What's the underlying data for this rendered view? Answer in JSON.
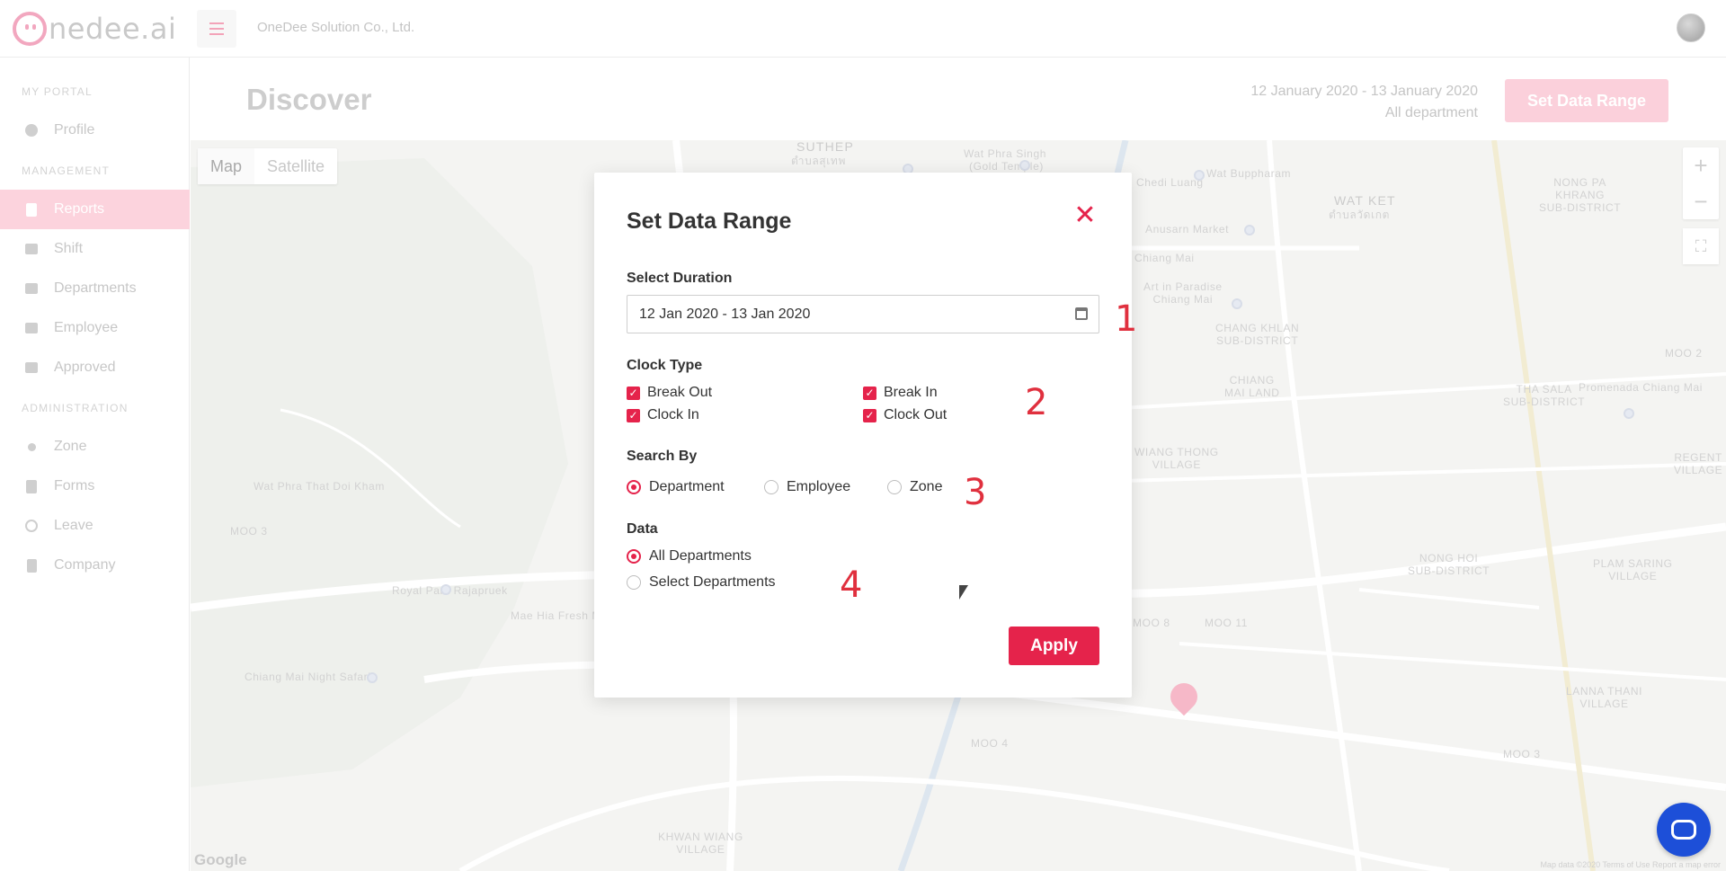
{
  "app": {
    "logo_text": "nedee.ai",
    "company_name": "OneDee Solution Co., Ltd."
  },
  "sidebar": {
    "sections": [
      {
        "title": "MY PORTAL"
      },
      {
        "title": "MANAGEMENT"
      },
      {
        "title": "ADMINISTRATION"
      }
    ],
    "items": [
      {
        "label": "Profile",
        "icon": "user-circle-icon"
      },
      {
        "label": "Reports",
        "icon": "file-icon",
        "active": true
      },
      {
        "label": "Shift",
        "icon": "shift-icon"
      },
      {
        "label": "Departments",
        "icon": "users-icon"
      },
      {
        "label": "Employee",
        "icon": "id-card-icon"
      },
      {
        "label": "Approved",
        "icon": "inbox-icon"
      },
      {
        "label": "Zone",
        "icon": "map-pin-icon"
      },
      {
        "label": "Forms",
        "icon": "clipboard-icon"
      },
      {
        "label": "Leave",
        "icon": "x-circle-icon"
      },
      {
        "label": "Company",
        "icon": "building-icon"
      }
    ]
  },
  "header": {
    "title": "Discover",
    "date_range": "12 January 2020 - 13 January 2020",
    "scope": "All department",
    "button_label": "Set Data Range"
  },
  "map": {
    "type_options": [
      "Map",
      "Satellite"
    ],
    "selected_type": "Map",
    "zoom_in": "+",
    "zoom_out": "−",
    "labels": {
      "suthep": "SUTHEP",
      "suthep_th": "ตำบลสุเทพ",
      "wat_phra_singh": "Wat Phra Singh",
      "golden_temple": "(Gold Temple)",
      "chedi_luang": "Chedi Luang",
      "wat_bupparam": "Wat Buppharam",
      "wat_ket": "WAT KET",
      "wat_ket_th": "ตำบลวัดเกต",
      "nong_pa_khrang": "NONG PA\nKHRANG\nSUB-DISTRICT",
      "anusarn": "Anusarn Market",
      "chiang_mai": "Chiang Mai",
      "art_in_paradise": "Art in Paradise\nChiang Mai",
      "chang_khlan": "CHANG KHLAN\nSUB-DISTRICT",
      "chiang_mai_land": "CHIANG\nMAI LAND",
      "tha_sala": "THA SALA\nSUB-DISTRICT",
      "moo2": "MOO 2",
      "promenada": "Promenada Chiang Mai",
      "regent": "REGENT\nVILLAGE",
      "wiang_thong": "WIANG THONG\nVILLAGE",
      "wat_phra_that": "Wat Phra That Doi Kham",
      "moo3_left": "MOO 3",
      "royal_park": "Royal Park Rajapruek",
      "mae_hia": "Mae Hia Fresh M",
      "night_safari": "Chiang Mai Night Safari",
      "nong_hoi": "NONG HOI\nSUB-DISTRICT",
      "plam_saring": "PLAM SARING\nVILLAGE",
      "moo8": "MOO 8",
      "moo11": "MOO 11",
      "lanna_thani": "LANNA THANI\nVILLAGE",
      "moo4": "MOO 4",
      "moo3_right": "MOO 3",
      "khwan_wiang": "KHWAN WIANG\nVILLAGE",
      "google": "Google",
      "map_data": "Map data ©2020   Terms of Use   Report a map error"
    }
  },
  "modal": {
    "title": "Set Data Range",
    "close_glyph": "✕",
    "duration_label": "Select Duration",
    "duration_value": "12 Jan 2020 - 13 Jan 2020",
    "clock_type_label": "Clock Type",
    "clock_types": [
      {
        "label": "Break Out",
        "checked": true
      },
      {
        "label": "Break In",
        "checked": true
      },
      {
        "label": "Clock In",
        "checked": true
      },
      {
        "label": "Clock Out",
        "checked": true
      }
    ],
    "search_by_label": "Search By",
    "search_by_options": [
      {
        "label": "Department",
        "selected": true
      },
      {
        "label": "Employee",
        "selected": false
      },
      {
        "label": "Zone",
        "selected": false
      }
    ],
    "data_label": "Data",
    "data_options": [
      {
        "label": "All Departments",
        "selected": true
      },
      {
        "label": "Select Departments",
        "selected": false
      }
    ],
    "apply_label": "Apply"
  },
  "annotations": [
    "1",
    "2",
    "3",
    "4"
  ],
  "colors": {
    "accent": "#e5234b",
    "accent_light": "#fbd0db",
    "chat": "#1d4fd8"
  }
}
